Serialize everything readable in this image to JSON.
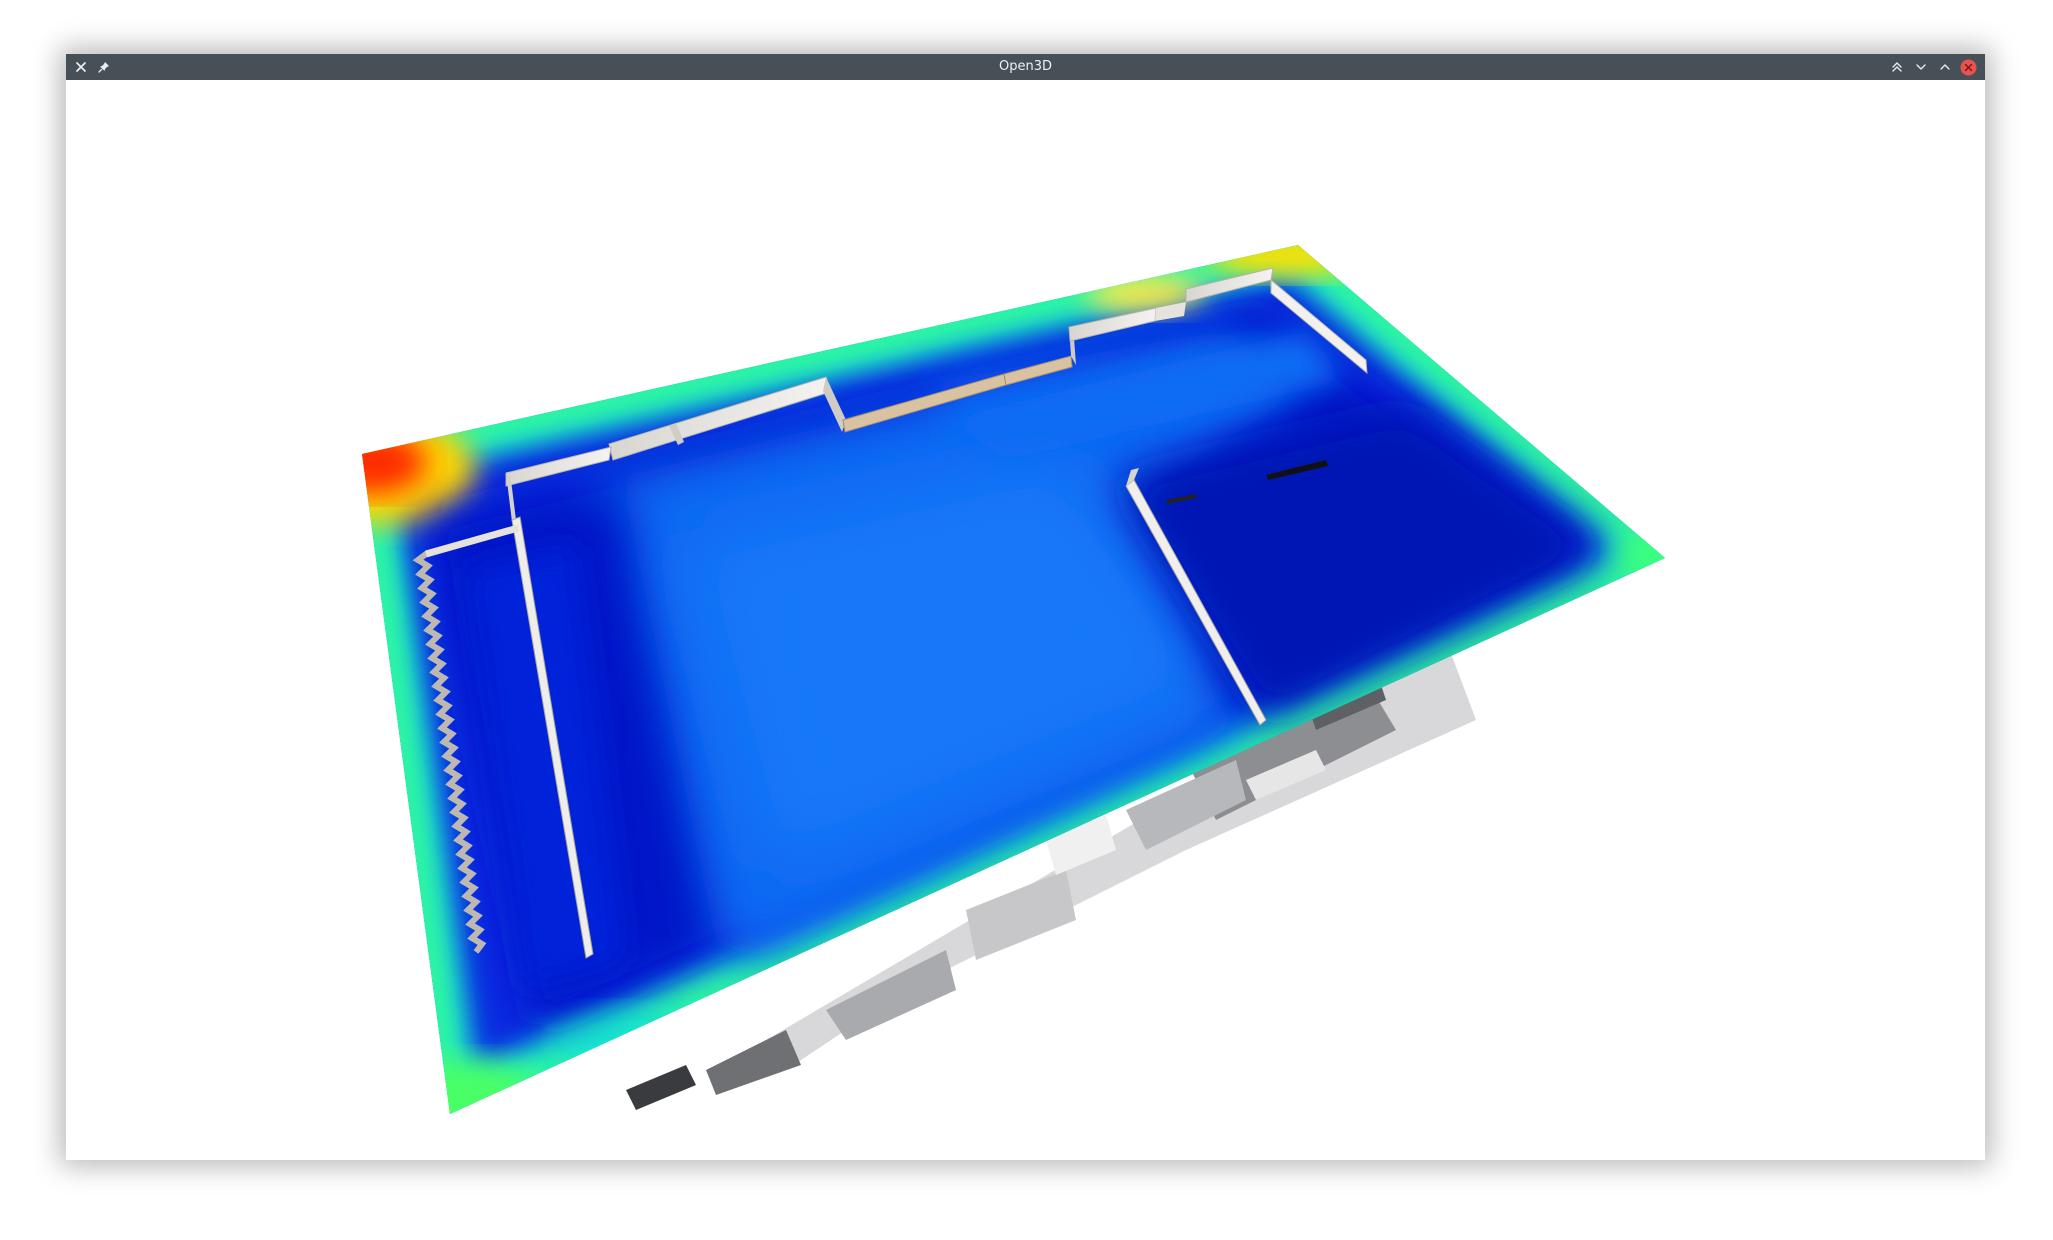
{
  "window": {
    "title": "Open3D"
  },
  "titlebar_buttons": {
    "close_left_icon": "close-icon",
    "pin_icon": "pin-icon",
    "keep_above_icon": "double-chevron-up-icon",
    "minimize_icon": "chevron-down-icon",
    "maximize_icon": "chevron-up-icon",
    "close_icon": "close-circle-icon"
  },
  "colors": {
    "titlebar": "#475057",
    "close_button": "#e9534f",
    "heatmap_low": "#0010c0",
    "heatmap_mid": "#0a6cf5",
    "heatmap_high": "#ff2000",
    "wall": "#e8e6e2"
  }
}
